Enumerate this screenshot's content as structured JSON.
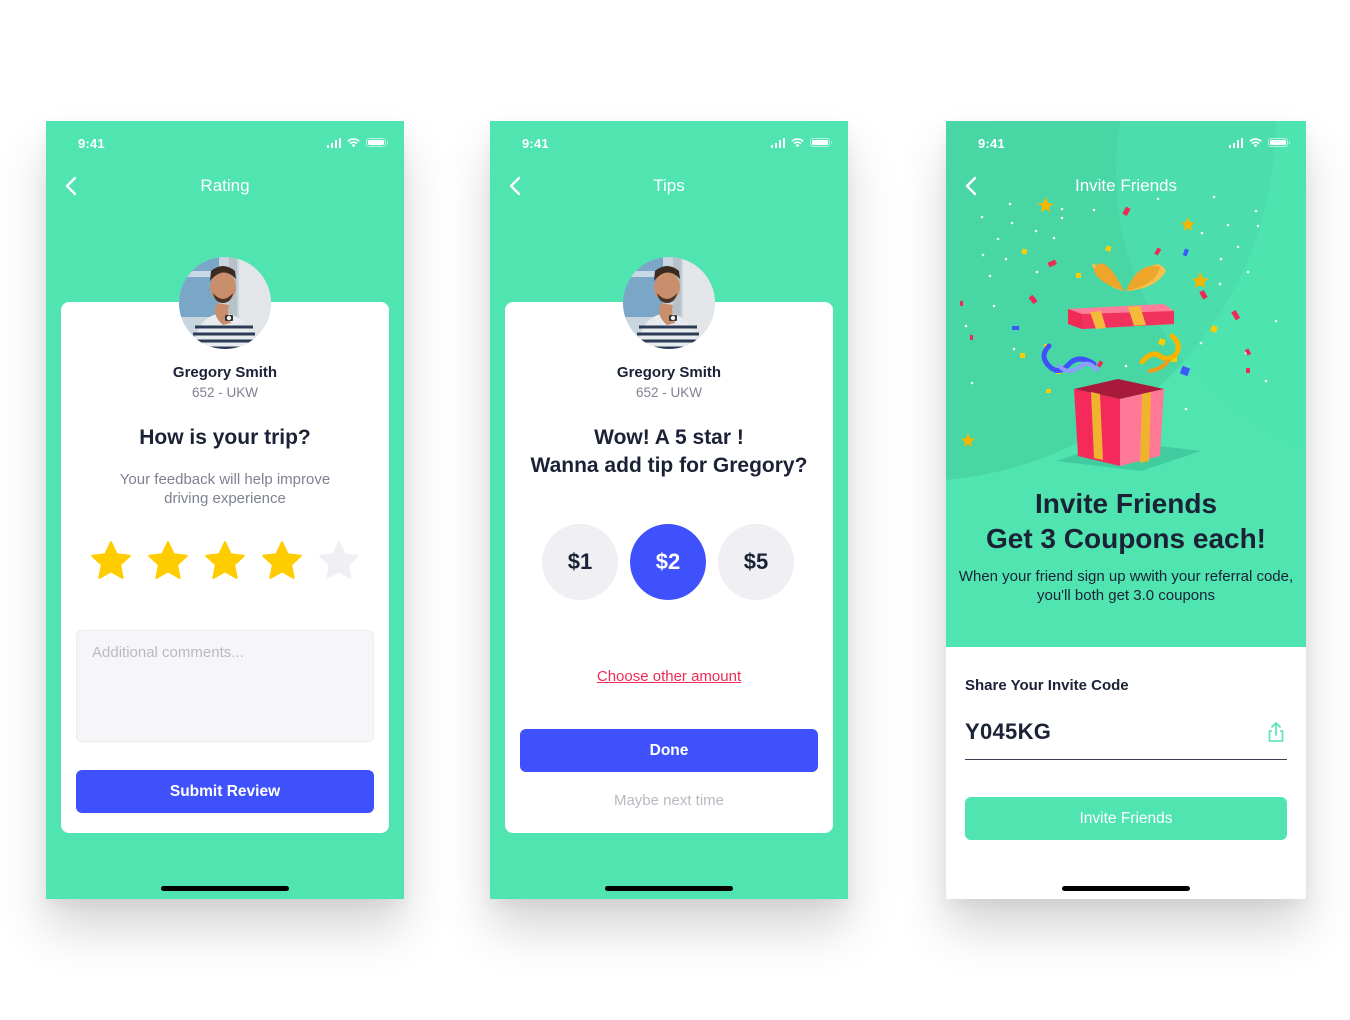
{
  "colors": {
    "mint": "#4fe4b0",
    "primary_blue": "#3f51fc",
    "star_gold": "#ffcc00",
    "star_empty": "#efeff4",
    "link_red": "#ef2a55",
    "text_dark": "#1b2236",
    "text_muted": "#7e8291"
  },
  "status_bar": {
    "time": "9:41",
    "icons": [
      "cellular-signal-icon",
      "wifi-icon",
      "battery-icon"
    ]
  },
  "screens": {
    "rating": {
      "title": "Rating",
      "back_icon": "chevron-left-icon",
      "driver": {
        "name": "Gregory Smith",
        "plate": "652 - UKW"
      },
      "heading": "How is your trip?",
      "subtitle": "Your feedback will help improve driving experience",
      "rating": {
        "value": 4,
        "max": 5
      },
      "comments": {
        "placeholder": "Additional comments...",
        "value": ""
      },
      "submit_label": "Submit Review"
    },
    "tips": {
      "title": "Tips",
      "back_icon": "chevron-left-icon",
      "driver": {
        "name": "Gregory Smith",
        "plate": "652 - UKW"
      },
      "heading_line1": "Wow! A 5 star !",
      "heading_line2": "Wanna add tip for Gregory?",
      "options": [
        {
          "label": "$1",
          "selected": false
        },
        {
          "label": "$2",
          "selected": true
        },
        {
          "label": "$5",
          "selected": false
        }
      ],
      "other_amount_label": "Choose other amount",
      "done_label": "Done",
      "skip_label": "Maybe next time"
    },
    "invite": {
      "title": "Invite Friends",
      "back_icon": "chevron-left-icon",
      "illustration": "open-gift-box-confetti",
      "heading_line1": "Invite Friends",
      "heading_line2": "Get 3 Coupons each!",
      "description": "When your friend sign up wwith your referral code, you'll both get 3.0 coupons",
      "share_label": "Share Your Invite Code",
      "invite_code": "Y045KG",
      "share_icon": "share-icon",
      "invite_button_label": "Invite Friends"
    }
  }
}
